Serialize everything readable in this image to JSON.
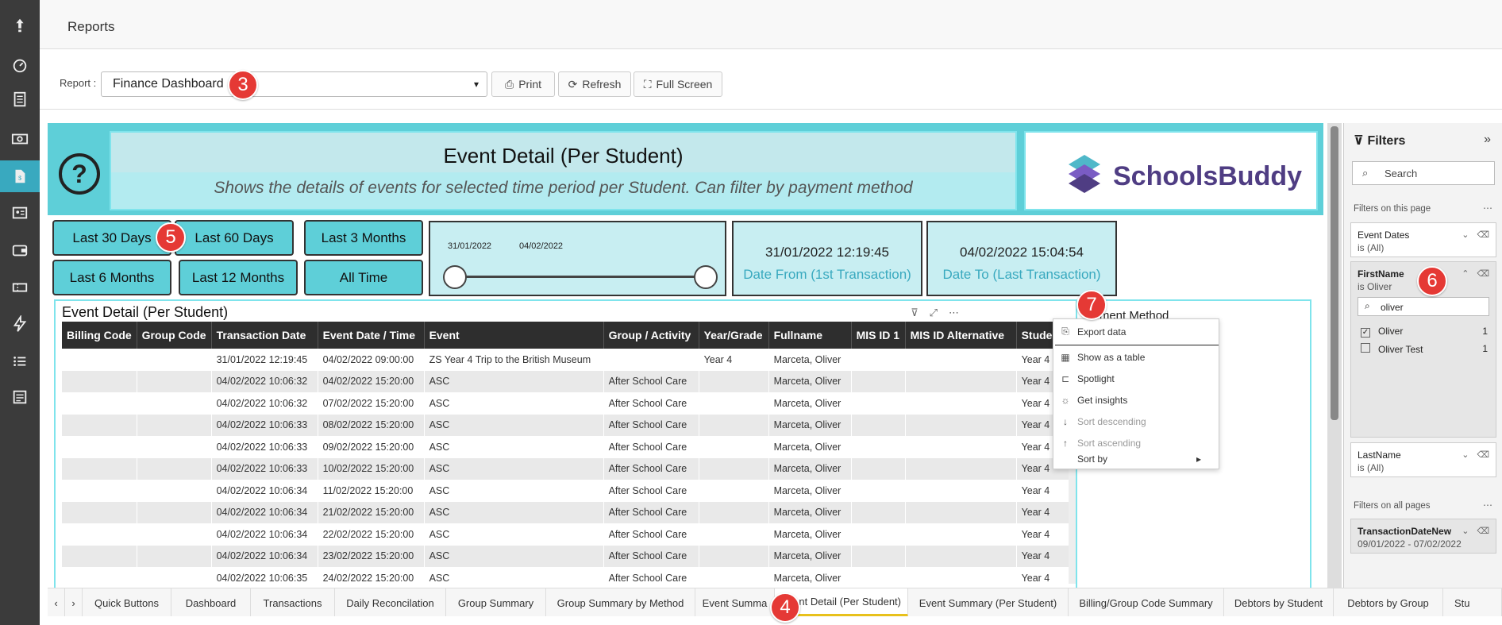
{
  "header": {
    "title": "Reports"
  },
  "report_bar": {
    "label": "Report :",
    "selected_report": "Finance Dashboard",
    "print_label": "Print",
    "refresh_label": "Refresh",
    "fullscreen_label": "Full Screen"
  },
  "report": {
    "title": "Event Detail (Per Student)",
    "subtitle": "Shows the details of events for selected time period per Student. Can filter by payment method",
    "logo_text": "SchoolsBuddy",
    "quick_buttons": [
      "Last 30 Days",
      "Last 60 Days",
      "Last 3 Months",
      "Last 6 Months",
      "Last 12 Months",
      "All Time"
    ],
    "slicer": {
      "start": "31/01/2022",
      "end": "04/02/2022"
    },
    "date_from": {
      "value": "31/01/2022 12:19:45",
      "label": "Date From (1st Transaction)"
    },
    "date_to": {
      "value": "04/02/2022 15:04:54",
      "label": "Date To (Last Transaction)"
    }
  },
  "table": {
    "title": "Event Detail (Per Student)",
    "columns": [
      "Billing Code",
      "Group Code",
      "Transaction Date",
      "Event Date / Time",
      "Event",
      "Group / Activity",
      "Year/Grade",
      "Fullname",
      "MIS ID 1",
      "MIS ID Alternative",
      "Student"
    ],
    "rows": [
      [
        "",
        "",
        "31/01/2022 12:19:45",
        "04/02/2022 09:00:00",
        "ZS Year 4 Trip to the British Museum",
        "",
        "Year 4",
        "Marceta, Oliver",
        "",
        "",
        "Year 4"
      ],
      [
        "",
        "",
        "04/02/2022 10:06:32",
        "04/02/2022 15:20:00",
        "ASC",
        "After School Care",
        "",
        "Marceta, Oliver",
        "",
        "",
        "Year 4"
      ],
      [
        "",
        "",
        "04/02/2022 10:06:32",
        "07/02/2022 15:20:00",
        "ASC",
        "After School Care",
        "",
        "Marceta, Oliver",
        "",
        "",
        "Year 4"
      ],
      [
        "",
        "",
        "04/02/2022 10:06:33",
        "08/02/2022 15:20:00",
        "ASC",
        "After School Care",
        "",
        "Marceta, Oliver",
        "",
        "",
        "Year 4"
      ],
      [
        "",
        "",
        "04/02/2022 10:06:33",
        "09/02/2022 15:20:00",
        "ASC",
        "After School Care",
        "",
        "Marceta, Oliver",
        "",
        "",
        "Year 4"
      ],
      [
        "",
        "",
        "04/02/2022 10:06:33",
        "10/02/2022 15:20:00",
        "ASC",
        "After School Care",
        "",
        "Marceta, Oliver",
        "",
        "",
        "Year 4"
      ],
      [
        "",
        "",
        "04/02/2022 10:06:34",
        "11/02/2022 15:20:00",
        "ASC",
        "After School Care",
        "",
        "Marceta, Oliver",
        "",
        "",
        "Year 4"
      ],
      [
        "",
        "",
        "04/02/2022 10:06:34",
        "21/02/2022 15:20:00",
        "ASC",
        "After School Care",
        "",
        "Marceta, Oliver",
        "",
        "",
        "Year 4"
      ],
      [
        "",
        "",
        "04/02/2022 10:06:34",
        "22/02/2022 15:20:00",
        "ASC",
        "After School Care",
        "",
        "Marceta, Oliver",
        "",
        "",
        "Year 4"
      ],
      [
        "",
        "",
        "04/02/2022 10:06:34",
        "23/02/2022 15:20:00",
        "ASC",
        "After School Care",
        "",
        "Marceta, Oliver",
        "",
        "",
        "Year 4"
      ],
      [
        "",
        "",
        "04/02/2022 10:06:35",
        "24/02/2022 15:20:00",
        "ASC",
        "After School Care",
        "",
        "Marceta, Oliver",
        "",
        "",
        "Year 4"
      ]
    ]
  },
  "payment_method": {
    "title": "ayment Method"
  },
  "context_menu": {
    "items": [
      "Export data",
      "Show as a table",
      "Spotlight",
      "Get insights",
      "Sort descending",
      "Sort ascending",
      "Sort by"
    ]
  },
  "filters": {
    "title": "Filters",
    "search_placeholder": "Search",
    "on_this_page": "Filters on this page",
    "on_all_pages": "Filters on all pages",
    "event_dates": {
      "name": "Event Dates",
      "value": "is (All)"
    },
    "firstname": {
      "name": "FirstName",
      "value": "is Oliver",
      "search_value": "oliver",
      "options": [
        {
          "label": "Oliver",
          "count": "1",
          "checked": true
        },
        {
          "label": "Oliver Test",
          "count": "1",
          "checked": false
        }
      ]
    },
    "lastname": {
      "name": "LastName",
      "value": "is (All)"
    },
    "transaction_date": {
      "name": "TransactionDateNew",
      "value": "09/01/2022 - 07/02/2022"
    }
  },
  "tabs": [
    "Quick Buttons",
    "Dashboard",
    "Transactions",
    "Daily Reconcilation",
    "Group Summary",
    "Group Summary by Method",
    "Event Summa",
    "Event Detail (Per Student)",
    "Event Summary (Per Student)",
    "Billing/Group Code Summary",
    "Debtors by Student",
    "Debtors by Group",
    "Stu"
  ],
  "badges": [
    "3",
    "5",
    "6",
    "7",
    "4"
  ]
}
